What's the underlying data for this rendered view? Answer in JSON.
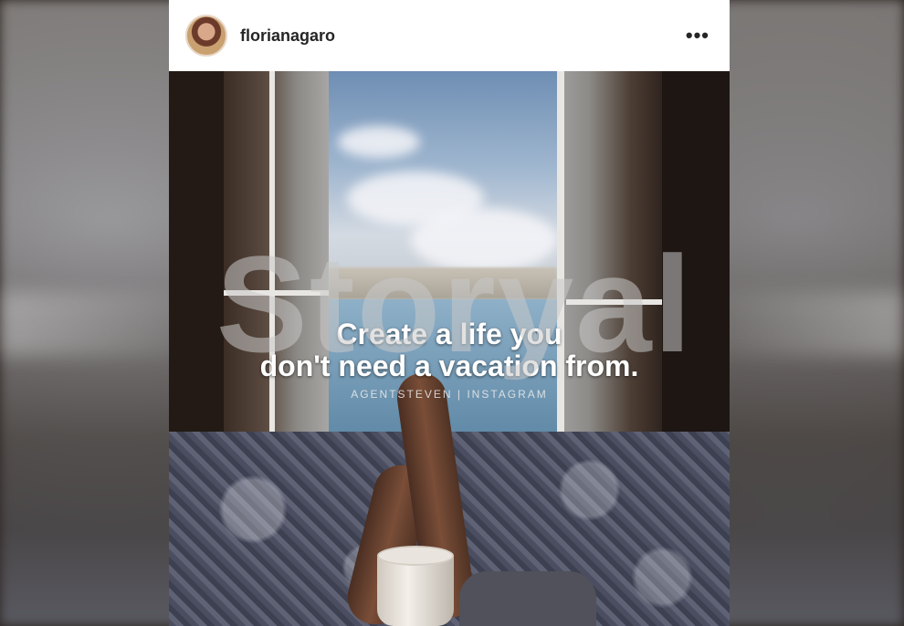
{
  "post": {
    "username": "florianagaro",
    "more_label": "•••",
    "quote_line_1": "Create a life you",
    "quote_line_2": "don't need a vacation from.",
    "credit": "AGENTSTEVEN | INSTAGRAM"
  },
  "watermark": "Storyal",
  "colors": {
    "header_bg": "#ffffff",
    "username_text": "#262626",
    "quote_text": "#ffffff"
  },
  "icons": [
    "more-options-icon"
  ]
}
